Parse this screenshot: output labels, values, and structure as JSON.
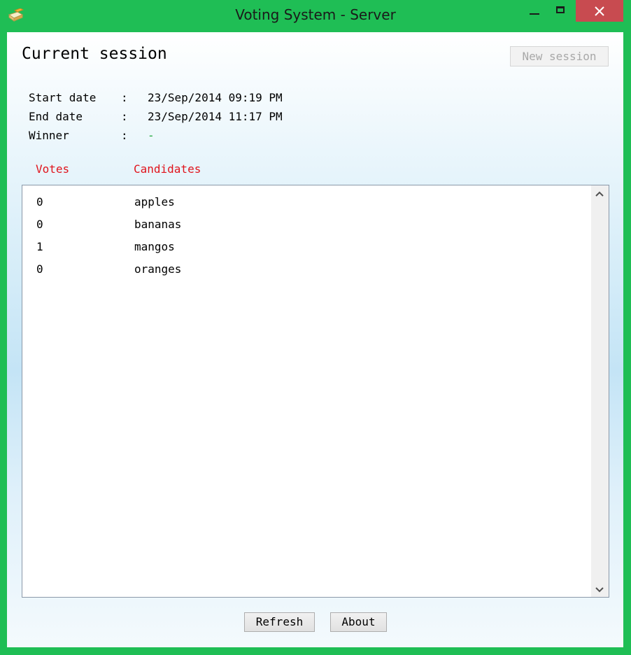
{
  "window": {
    "title": "Voting System - Server",
    "accent_color": "#1fbe55",
    "close_color": "#c84b50",
    "icons": [
      "app-icon",
      "minimize-icon",
      "maximize-icon",
      "close-icon"
    ]
  },
  "header": {
    "title": "Current session",
    "new_session_label": "New session"
  },
  "session": {
    "start_label": "Start date",
    "start_value": "23/Sep/2014 09:19 PM",
    "end_label": "End date",
    "end_value": "23/Sep/2014 11:17 PM",
    "winner_label": "Winner",
    "winner_value": "-",
    "separator": ":"
  },
  "table": {
    "headers": [
      "Votes",
      "Candidates"
    ],
    "header_color": "#e0141c",
    "rows": [
      {
        "votes": "0",
        "candidate": "apples"
      },
      {
        "votes": "0",
        "candidate": "bananas"
      },
      {
        "votes": "1",
        "candidate": "mangos"
      },
      {
        "votes": "0",
        "candidate": "oranges"
      }
    ]
  },
  "footer": {
    "refresh_label": "Refresh",
    "about_label": "About"
  }
}
